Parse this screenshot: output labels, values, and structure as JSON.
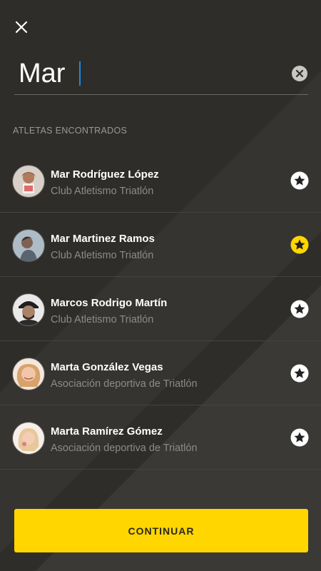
{
  "search": {
    "query": "Mar"
  },
  "section_title": "ATLETAS ENCONTRADOS",
  "athletes": [
    {
      "name": "Mar Rodríguez López",
      "club": "Club Atletismo Triatlón",
      "favorite": false
    },
    {
      "name": "Mar Martinez Ramos",
      "club": "Club Atletismo Triatlón",
      "favorite": true
    },
    {
      "name": "Marcos Rodrigo Martín",
      "club": "Club Atletismo Triatlón",
      "favorite": false
    },
    {
      "name": "Marta González Vegas",
      "club": "Asociación deportiva de Triatlón",
      "favorite": false
    },
    {
      "name": "Marta Ramírez Gómez",
      "club": "Asociación deportiva de Triatlón",
      "favorite": false
    }
  ],
  "continue_label": "CONTINUAR",
  "colors": {
    "accent": "#ffd600",
    "background": "#2f2d29",
    "caret": "#1e88e5"
  },
  "icons": {
    "close": "close-icon",
    "clear": "clear-circle-icon",
    "favorite": "star-icon"
  }
}
